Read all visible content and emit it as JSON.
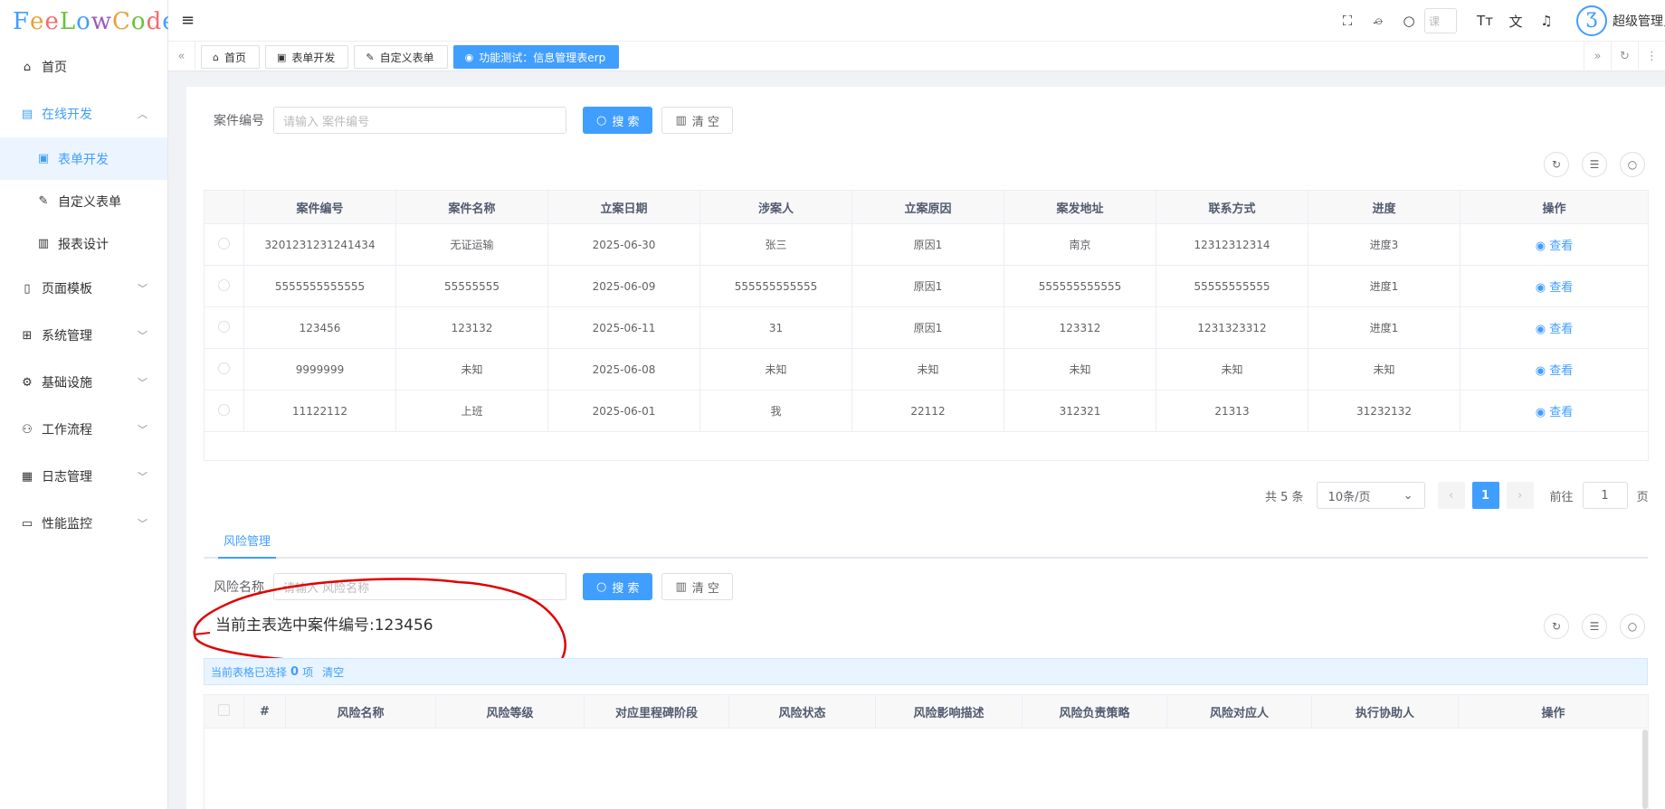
{
  "logo": {
    "text": "FeeLowCode"
  },
  "sidebar": {
    "items": [
      {
        "label": "首页",
        "icon": "home-icon",
        "glyph": "⌂"
      },
      {
        "label": "在线开发",
        "icon": "code-icon",
        "glyph": "▤",
        "open": true
      },
      {
        "label": "页面模板",
        "icon": "template-icon",
        "glyph": "▯"
      },
      {
        "label": "系统管理",
        "icon": "grid-icon",
        "glyph": "⊞"
      },
      {
        "label": "基础设施",
        "icon": "infrastructure-icon",
        "glyph": "⚙"
      },
      {
        "label": "工作流程",
        "icon": "flow-icon",
        "glyph": "⚇"
      },
      {
        "label": "日志管理",
        "icon": "log-icon",
        "glyph": "▦"
      },
      {
        "label": "性能监控",
        "icon": "monitor-icon",
        "glyph": "▭"
      }
    ],
    "submenu": [
      {
        "label": "表单开发",
        "icon": "form-icon",
        "glyph": "▣",
        "active": true
      },
      {
        "label": "自定义表单",
        "icon": "edit-form-icon",
        "glyph": "✎"
      },
      {
        "label": "报表设计",
        "icon": "report-icon",
        "glyph": "▥"
      }
    ]
  },
  "header": {
    "search_placeholder": "课",
    "username": "超级管理员",
    "avatar_text": "Ʒ"
  },
  "tabs": [
    {
      "label": "首页",
      "glyph": "⌂"
    },
    {
      "label": "表单开发",
      "glyph": "▣"
    },
    {
      "label": "自定义表单",
      "glyph": "✎"
    },
    {
      "label": "功能测试：信息管理表erp",
      "glyph": "◉",
      "active": true
    }
  ],
  "main_search": {
    "label": "案件编号",
    "placeholder": "请输入 案件编号",
    "search_label": "搜 索",
    "clear_label": "清 空"
  },
  "main_table": {
    "columns": [
      "案件编号",
      "案件名称",
      "立案日期",
      "涉案人",
      "立案原因",
      "案发地址",
      "联系方式",
      "进度",
      "操作"
    ],
    "rows": [
      [
        "3201231231241434",
        "无证运输",
        "2025-06-30",
        "张三",
        "原因1",
        "南京",
        "12312312314",
        "进度3"
      ],
      [
        "5555555555555",
        "55555555",
        "2025-06-09",
        "555555555555",
        "原因1",
        "555555555555",
        "55555555555",
        "进度1"
      ],
      [
        "123456",
        "123132",
        "2025-06-11",
        "31",
        "原因1",
        "123312",
        "1231323312",
        "进度1"
      ],
      [
        "9999999",
        "未知",
        "2025-06-08",
        "未知",
        "未知",
        "未知",
        "未知",
        "未知"
      ],
      [
        "11122112",
        "上班",
        "2025-06-01",
        "我",
        "22112",
        "312321",
        "21313",
        "31232132"
      ]
    ],
    "action_label": "查看"
  },
  "pagination": {
    "total_label": "共 5 条",
    "page_size": "10条/页",
    "current_page": "1",
    "goto_label": "前往",
    "goto_value": "1",
    "page_suffix": "页"
  },
  "sub_section": {
    "tab_label": "风险管理",
    "search_label": "风险名称",
    "placeholder": "请输入 风险名称",
    "search_button": "搜 索",
    "clear_button": "清 空",
    "selected_note": "当前主表选中案件编号:123456",
    "selection_prefix": "当前表格已选择",
    "selection_count": "0",
    "selection_unit": "项",
    "selection_clear": "清空",
    "columns": [
      "#",
      "风险名称",
      "风险等级",
      "对应里程碑阶段",
      "风险状态",
      "风险影响描述",
      "风险负责策略",
      "风险对应人",
      "执行协助人",
      "操作"
    ]
  },
  "colors": {
    "primary": "#409eff",
    "annotation": "#e00000"
  }
}
